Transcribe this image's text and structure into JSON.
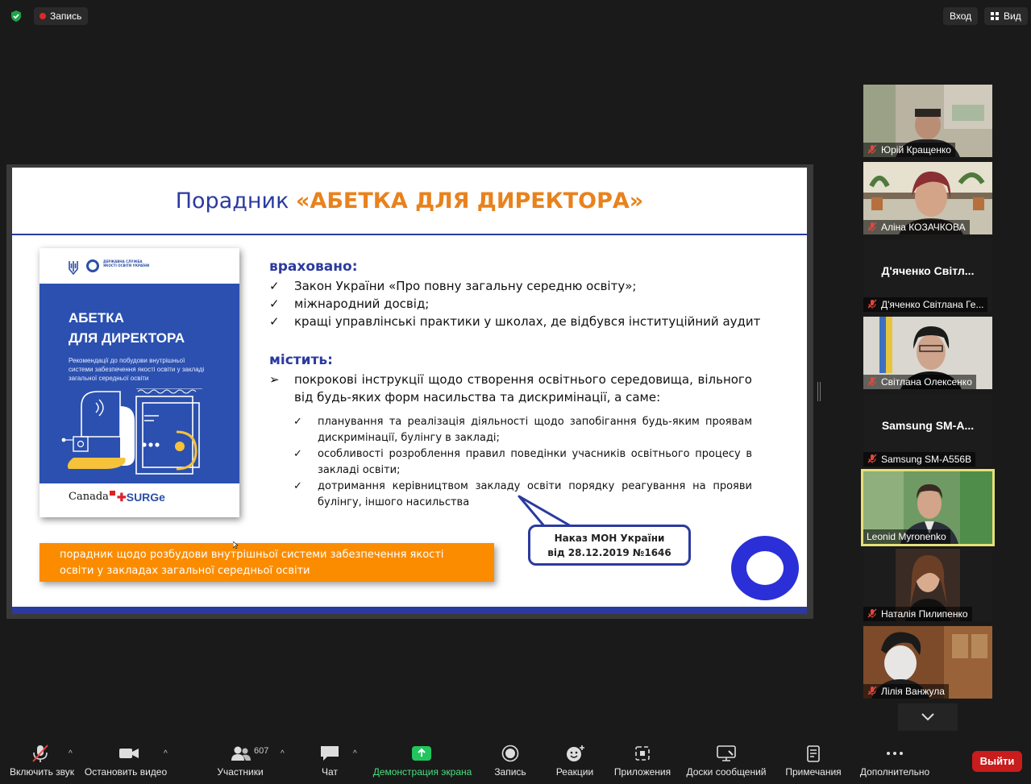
{
  "topbar": {
    "record_label": "Запись",
    "enter_label": "Вход",
    "view_label": "Вид",
    "security_icon": "shield-check-icon"
  },
  "slide": {
    "title_prefix": "Порадник ",
    "title_accent": "«АБЕТКА ДЛЯ ДИРЕКТОРА»",
    "book": {
      "org": "ДЕРЖАВНА СЛУЖБА ЯКОСТІ ОСВІТИ УКРАЇНИ",
      "title_line1": "АБЕТКА",
      "title_line2": "ДЛЯ ДИРЕКТОРА",
      "subtitle": "Рекомендації до побудови внутрішньої системи забезпечення якості освіти у закладі загальної середньої освіти",
      "partner1": "Canada",
      "partner2": "SURGe"
    },
    "section1": {
      "heading": "враховано:",
      "items": [
        "Закон України «Про повну загальну середню освіту»;",
        "міжнародний досвід;",
        "кращі управлінські практики у школах, де відбувся інституційний аудит"
      ]
    },
    "section2": {
      "heading": "містить:",
      "lead": "покрокові інструкції щодо створення освітнього середовища, вільного від будь-яких форм насильства та дискримінації, а саме:",
      "items": [
        "планування та реалізація діяльності щодо запобігання будь-яким проявам дискримінації, булінгу в закладі;",
        "особливості розроблення правил поведінки учасників освітнього процесу в закладі освіти;",
        "дотримання керівництвом закладу освіти порядку реагування на прояви булінгу, іншого насильства"
      ]
    },
    "orange_note": "порадник щодо розбудови внутрішньої системи забезпечення якості освіти у закладах загальної середньої освіти",
    "callout_line1": "Наказ МОН України",
    "callout_line2": "від 28.12.2019 №1646",
    "check_mark": "✓",
    "arrow_mark": "➢",
    "colors": {
      "primary_blue": "#2b3aa0",
      "accent_orange": "#e8821d",
      "orange_box": "#fb8c00",
      "book_blue": "#2b50b0"
    }
  },
  "participants": [
    {
      "name": "Юрій Кращенко",
      "muted": true,
      "video": true
    },
    {
      "name": "Аліна КОЗАЧКОВА",
      "muted": true,
      "video": true
    },
    {
      "name": "Д'яченко Світлана Ге...",
      "display": "Д'яченко Світл...",
      "muted": true,
      "video": false
    },
    {
      "name": "Світлана Олексенко",
      "muted": true,
      "video": true
    },
    {
      "name": "Samsung SM-A556B",
      "display": "Samsung SM-A...",
      "muted": true,
      "video": false
    },
    {
      "name": "Leonid Myronenko",
      "muted": false,
      "video": true,
      "active": true
    },
    {
      "name": "Наталія Пилипенко",
      "muted": true,
      "video": true
    },
    {
      "name": "Лілія Ванжула",
      "muted": true,
      "video": true
    }
  ],
  "toolbar": {
    "unmute": "Включить звук",
    "stop_video": "Остановить видео",
    "participants": "Участники",
    "participants_count": "607",
    "chat": "Чат",
    "share_screen": "Демонстрация экрана",
    "record": "Запись",
    "reactions": "Реакции",
    "apps": "Приложения",
    "whiteboards": "Доски сообщений",
    "notes": "Примечания",
    "more": "Дополнительно",
    "leave": "Выйти",
    "caret": "^"
  }
}
